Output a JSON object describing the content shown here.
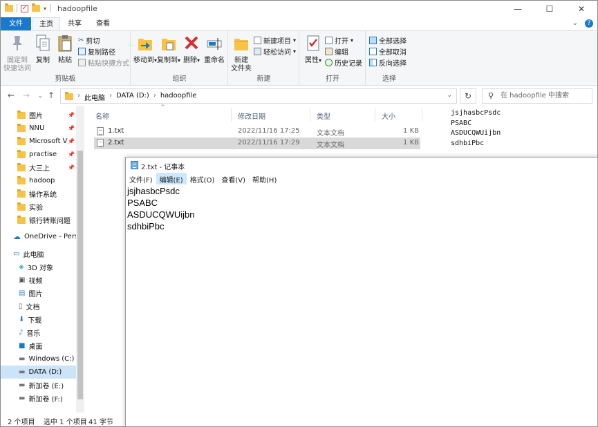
{
  "window": {
    "title": "hadoopfile",
    "controls": {
      "minimize": "—",
      "maximize": "☐",
      "close": "✕"
    }
  },
  "ribbon": {
    "tabs": [
      {
        "label": "文件"
      },
      {
        "label": "主页"
      },
      {
        "label": "共享"
      },
      {
        "label": "查看"
      }
    ],
    "groups": {
      "clipboard": {
        "label": "剪贴板",
        "pin": "固定到\n快速访问",
        "pin_line1": "固定到",
        "pin_line2": "快速访问",
        "copy": "复制",
        "paste": "粘贴",
        "cut": "剪切",
        "copy_path": "复制路径",
        "paste_shortcut": "粘贴快捷方式"
      },
      "organize": {
        "label": "组织",
        "move_to": "移动到",
        "copy_to": "复制到",
        "delete": "删除",
        "rename": "重命名"
      },
      "new": {
        "label": "新建",
        "new_folder_line1": "新建",
        "new_folder_line2": "文件夹",
        "new_item": "新建项目",
        "easy_access": "轻松访问"
      },
      "open": {
        "label": "打开",
        "properties": "属性",
        "open": "打开",
        "edit": "编辑",
        "history": "历史记录"
      },
      "select": {
        "label": "选择",
        "select_all": "全部选择",
        "select_none": "全部取消",
        "invert": "反向选择"
      }
    }
  },
  "address": {
    "crumbs": [
      "此电脑",
      "DATA (D:)",
      "hadoopfile"
    ],
    "search_placeholder": "在 hadoopfile 中搜索"
  },
  "navpane": {
    "items": [
      {
        "label": "图片",
        "pinned": true,
        "icon": "folder-picture-icon"
      },
      {
        "label": "NNU",
        "pinned": true,
        "icon": "folder-icon"
      },
      {
        "label": "Microsoft V",
        "pinned": true,
        "icon": "folder-icon"
      },
      {
        "label": "practise",
        "pinned": true,
        "icon": "folder-icon"
      },
      {
        "label": "大三上",
        "pinned": true,
        "icon": "folder-icon"
      },
      {
        "label": "hadoop",
        "pinned": false,
        "icon": "folder-icon"
      },
      {
        "label": "操作系统",
        "pinned": false,
        "icon": "folder-icon"
      },
      {
        "label": "实验",
        "pinned": false,
        "icon": "folder-icon"
      },
      {
        "label": "银行转账问题",
        "pinned": false,
        "icon": "folder-icon"
      },
      {
        "label": "OneDrive - Pers",
        "pinned": false,
        "icon": "cloud-icon"
      },
      {
        "label": "此电脑",
        "pinned": false,
        "icon": "computer-icon"
      },
      {
        "label": "3D 对象",
        "pinned": false,
        "icon": "cube-icon"
      },
      {
        "label": "视频",
        "pinned": false,
        "icon": "video-icon"
      },
      {
        "label": "图片",
        "pinned": false,
        "icon": "picture-icon"
      },
      {
        "label": "文档",
        "pinned": false,
        "icon": "document-icon"
      },
      {
        "label": "下载",
        "pinned": false,
        "icon": "download-icon"
      },
      {
        "label": "音乐",
        "pinned": false,
        "icon": "music-icon"
      },
      {
        "label": "桌面",
        "pinned": false,
        "icon": "desktop-icon"
      },
      {
        "label": "Windows (C:)",
        "pinned": false,
        "icon": "drive-icon"
      },
      {
        "label": "DATA (D:)",
        "pinned": false,
        "icon": "drive-icon"
      },
      {
        "label": "新加卷 (E:)",
        "pinned": false,
        "icon": "drive-icon"
      },
      {
        "label": "新加卷 (F:)",
        "pinned": false,
        "icon": "drive-icon"
      }
    ]
  },
  "filelist": {
    "columns": {
      "name": "名称",
      "date": "修改日期",
      "type": "类型",
      "size": "大小"
    },
    "rows": [
      {
        "name": "1.txt",
        "date": "2022/11/16 17:25",
        "type": "文本文档",
        "size": "1 KB"
      },
      {
        "name": "2.txt",
        "date": "2022/11/16 17:29",
        "type": "文本文档",
        "size": "1 KB"
      }
    ]
  },
  "preview": {
    "lines": [
      "jsjhasbcPsdc",
      "PSABC",
      "ASDUCQWUijbn",
      "sdhbiPbc"
    ]
  },
  "statusbar": {
    "count": "2 个项目",
    "selected": "选中 1 个项目",
    "bytes": "41 字节"
  },
  "notepad": {
    "title": "2.txt - 记事本",
    "menu": [
      "文件(F)",
      "编辑(E)",
      "格式(O)",
      "查看(V)",
      "帮助(H)"
    ],
    "content": [
      "jsjhasbcPsdc",
      "PSABC",
      "ASDUCQWUijbn",
      "sdhbiPbc"
    ]
  },
  "colors": {
    "accent": "#1979ca",
    "selection": "#cce4f7",
    "row_selected": "#d9d9d9",
    "folder": "#f6c347"
  }
}
